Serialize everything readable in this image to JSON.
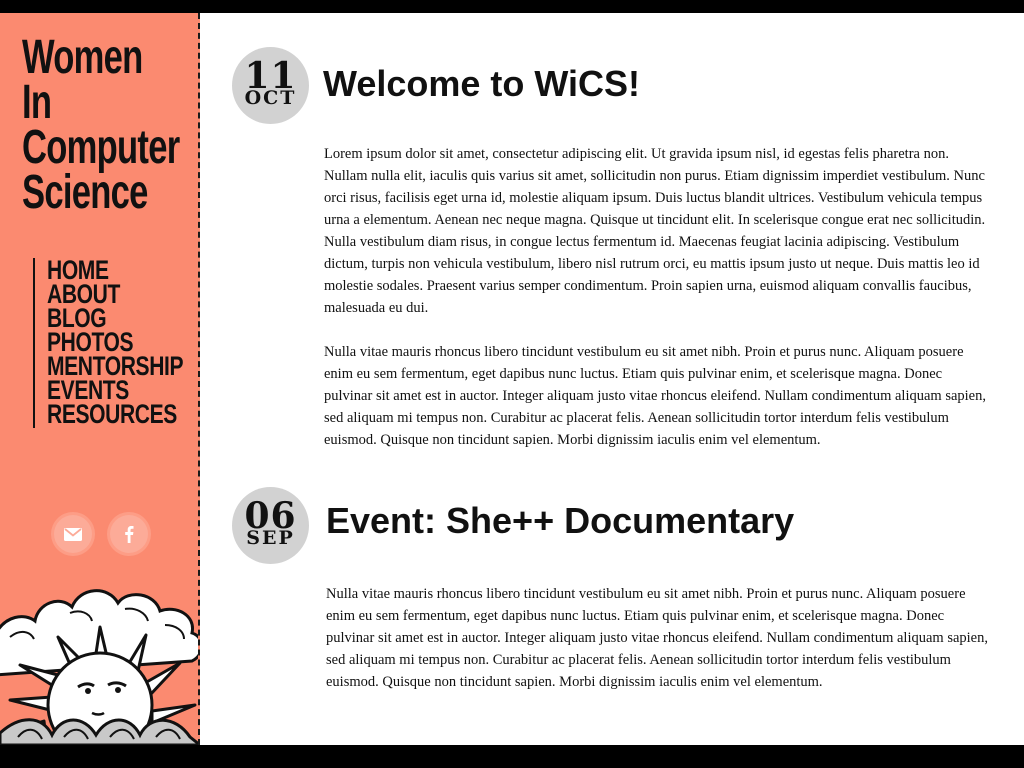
{
  "site": {
    "title_lines": [
      "Women",
      "In",
      "Computer",
      "Science"
    ]
  },
  "nav": {
    "items": [
      "HOME",
      "ABOUT",
      "BLOG",
      "PHOTOS",
      "MENTORSHIP",
      "EVENTS",
      "RESOURCES"
    ]
  },
  "social": {
    "mail_icon": "mail-icon",
    "facebook_icon": "facebook-icon"
  },
  "posts": [
    {
      "day": "11",
      "month": "OCT",
      "title": "Welcome to WiCS!",
      "paragraphs": [
        "Lorem ipsum dolor sit amet, consectetur adipiscing elit. Ut gravida ipsum nisl, id egestas felis pharetra non. Nullam nulla elit, iaculis quis varius sit amet, sollicitudin non purus. Etiam dignissim imperdiet vestibulum. Nunc orci risus, facilisis eget urna id, molestie aliquam ipsum. Duis luctus blandit ultrices. Vestibulum vehicula tempus urna a elementum. Aenean nec neque magna. Quisque ut tincidunt elit. In scelerisque congue erat nec sollicitudin. Nulla vestibulum diam risus, in congue lectus fermentum id. Maecenas feugiat lacinia adipiscing. Vestibulum dictum, turpis non vehicula vestibulum, libero nisl rutrum orci, eu mattis ipsum justo ut neque. Duis mattis leo id molestie sodales. Praesent varius semper condimentum. Proin sapien urna, euismod aliquam convallis faucibus, malesuada eu dui.",
        "Nulla vitae mauris rhoncus libero tincidunt vestibulum eu sit amet nibh. Proin et purus nunc. Aliquam posuere enim eu sem fermentum, eget dapibus nunc luctus. Etiam quis pulvinar enim, et scelerisque magna. Donec pulvinar sit amet est in auctor. Integer aliquam justo vitae rhoncus eleifend. Nullam condimentum aliquam sapien, sed aliquam mi tempus non. Curabitur ac placerat felis. Aenean sollicitudin tortor interdum felis vestibulum euismod. Quisque non tincidunt sapien. Morbi dignissim iaculis enim vel elementum."
      ]
    },
    {
      "day": "06",
      "month": "SEP",
      "title": "Event: She++ Documentary",
      "paragraphs": [
        "Nulla vitae mauris rhoncus libero tincidunt vestibulum eu sit amet nibh. Proin et purus nunc. Aliquam posuere enim eu sem fermentum, eget dapibus nunc luctus. Etiam quis pulvinar enim, et scelerisque magna. Donec pulvinar sit amet est in auctor. Integer aliquam justo vitae rhoncus eleifend. Nullam condimentum aliquam sapien, sed aliquam mi tempus non. Curabitur ac placerat felis. Aenean sollicitudin tortor interdum felis vestibulum euismod. Quisque non tincidunt sapien. Morbi dignissim iaculis enim vel elementum."
      ]
    }
  ],
  "colors": {
    "sidebar_bg": "#fb8a70",
    "date_badge_bg": "#d2d2d2",
    "text": "#111111"
  }
}
